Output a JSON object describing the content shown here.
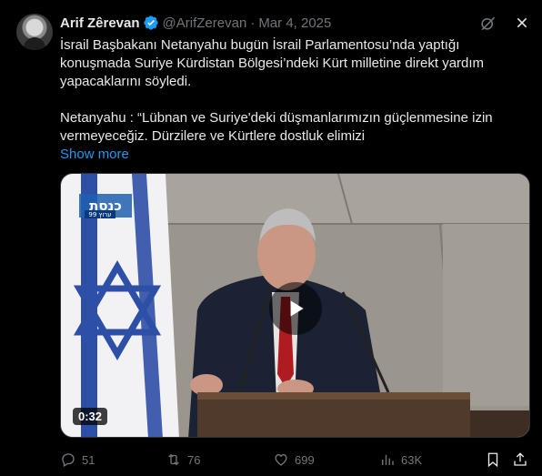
{
  "author": {
    "name": "Arif Zêrevan",
    "handle": "@ArifZerevan",
    "separator": "·",
    "date": "Mar 4, 2025"
  },
  "tweet": {
    "paragraph1": "İsrail Başbakanı Netanyahu bugün İsrail Parlamentosu’nda yaptığı konuşmada Suriye Kürdistan Bölgesi’ndeki Kürt milletine direkt yardım yapacaklarını söyledi.",
    "paragraph2": "Netanyahu : “Lübnan ve Suriye'deki düşmanlarımızın güçlenmesine izin vermeyeceğiz. Dürzilere ve Kürtlere dostluk elimizi",
    "show_more": "Show more"
  },
  "media": {
    "channel_logo": "כנסת",
    "channel_sub": "ערוץ 99",
    "duration": "0:32"
  },
  "actions": {
    "replies": "51",
    "reposts": "76",
    "likes": "699",
    "views": "63K"
  },
  "icons": [
    "verified-icon",
    "grok-icon",
    "close-icon",
    "reply-icon",
    "repost-icon",
    "like-icon",
    "views-icon",
    "bookmark-icon",
    "share-icon",
    "play-icon"
  ],
  "colors": {
    "accent": "#1d9bf0",
    "muted": "#71767b",
    "text": "#e7e9ea",
    "background": "#000000"
  }
}
